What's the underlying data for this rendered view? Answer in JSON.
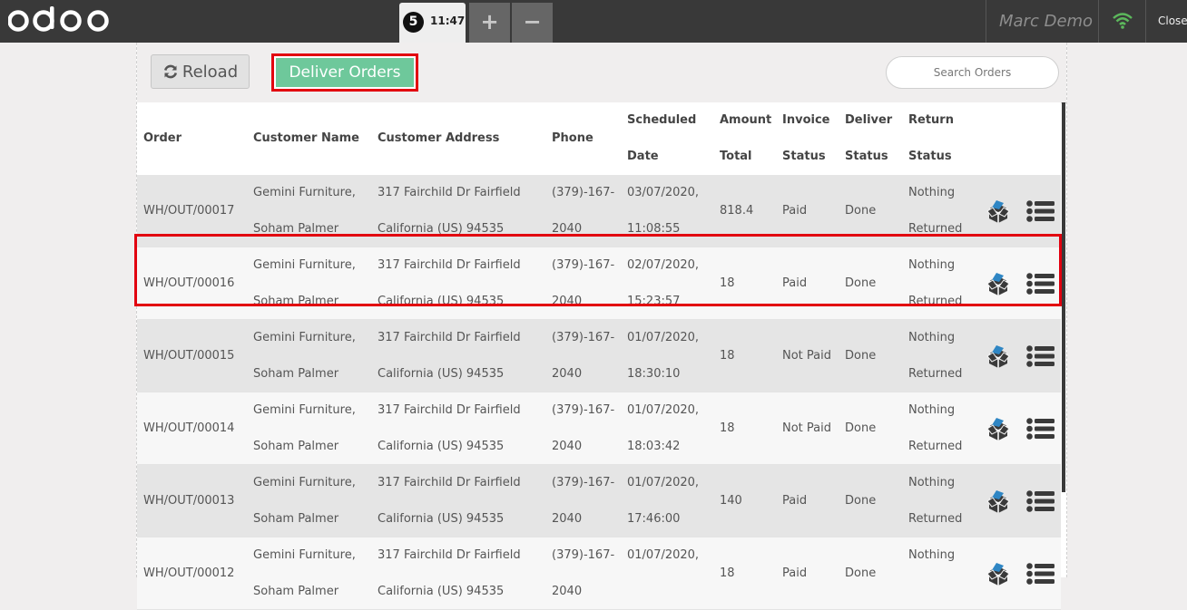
{
  "header": {
    "order_number": "5",
    "order_time": "11:47",
    "add_label": "+",
    "remove_label": "−",
    "user_name": "Marc Demo",
    "close_label": "Close",
    "logo_text": "odoo"
  },
  "controls": {
    "reload_label": "Reload",
    "deliver_label": "Deliver Orders",
    "search_placeholder": "Search Orders"
  },
  "table": {
    "headers": {
      "order": "Order",
      "customer_name": "Customer Name",
      "customer_address": "Customer Address",
      "phone": "Phone",
      "scheduled_1": "Scheduled",
      "scheduled_2": "Date",
      "amount_1": "Amount",
      "amount_2": "Total",
      "invoice_1": "Invoice",
      "invoice_2": "Status",
      "deliver_1": "Deliver",
      "deliver_2": "Status",
      "return_1": "Return",
      "return_2": "Status"
    },
    "rows": [
      {
        "order": "WH/OUT/00017",
        "name_1": "Gemini Furniture,",
        "name_2": "Soham Palmer",
        "addr_1": "317 Fairchild Dr Fairfield",
        "addr_2": "California (US) 94535",
        "phone_1": "(379)-167-",
        "phone_2": "2040",
        "date_1": "03/07/2020,",
        "date_2": "11:08:55",
        "amount": "818.4",
        "invoice": "Paid",
        "deliver": "Done",
        "return_1": "Nothing",
        "return_2": "Returned"
      },
      {
        "order": "WH/OUT/00016",
        "name_1": "Gemini Furniture,",
        "name_2": "Soham Palmer",
        "addr_1": "317 Fairchild Dr Fairfield",
        "addr_2": "California (US) 94535",
        "phone_1": "(379)-167-",
        "phone_2": "2040",
        "date_1": "02/07/2020,",
        "date_2": "15:23:57",
        "amount": "18",
        "invoice": "Paid",
        "deliver": "Done",
        "return_1": "Nothing",
        "return_2": "Returned"
      },
      {
        "order": "WH/OUT/00015",
        "name_1": "Gemini Furniture,",
        "name_2": "Soham Palmer",
        "addr_1": "317 Fairchild Dr Fairfield",
        "addr_2": "California (US) 94535",
        "phone_1": "(379)-167-",
        "phone_2": "2040",
        "date_1": "01/07/2020,",
        "date_2": "18:30:10",
        "amount": "18",
        "invoice": "Not Paid",
        "deliver": "Done",
        "return_1": "Nothing",
        "return_2": "Returned"
      },
      {
        "order": "WH/OUT/00014",
        "name_1": "Gemini Furniture,",
        "name_2": "Soham Palmer",
        "addr_1": "317 Fairchild Dr Fairfield",
        "addr_2": "California (US) 94535",
        "phone_1": "(379)-167-",
        "phone_2": "2040",
        "date_1": "01/07/2020,",
        "date_2": "18:03:42",
        "amount": "18",
        "invoice": "Not Paid",
        "deliver": "Done",
        "return_1": "Nothing",
        "return_2": "Returned"
      },
      {
        "order": "WH/OUT/00013",
        "name_1": "Gemini Furniture,",
        "name_2": "Soham Palmer",
        "addr_1": "317 Fairchild Dr Fairfield",
        "addr_2": "California (US) 94535",
        "phone_1": "(379)-167-",
        "phone_2": "2040",
        "date_1": "01/07/2020,",
        "date_2": "17:46:00",
        "amount": "140",
        "invoice": "Paid",
        "deliver": "Done",
        "return_1": "Nothing",
        "return_2": "Returned"
      },
      {
        "order": "WH/OUT/00012",
        "name_1": "Gemini Furniture,",
        "name_2": "Soham Palmer",
        "addr_1": "317 Fairchild Dr Fairfield",
        "addr_2": "California (US) 94535",
        "phone_1": "(379)-167-",
        "phone_2": "2040",
        "date_1": "01/07/2020,",
        "date_2": "",
        "amount": "18",
        "invoice": "Paid",
        "deliver": "Done",
        "return_1": "Nothing",
        "return_2": ""
      }
    ]
  },
  "icons": {
    "return_action": "open-box-icon",
    "details_action": "list-icon",
    "reload": "refresh-icon",
    "network": "wifi-icon"
  },
  "colors": {
    "topbar": "#393939",
    "deliver_button": "#6ec89b",
    "highlight": "#e2000f",
    "wifi": "#5cb85c"
  }
}
